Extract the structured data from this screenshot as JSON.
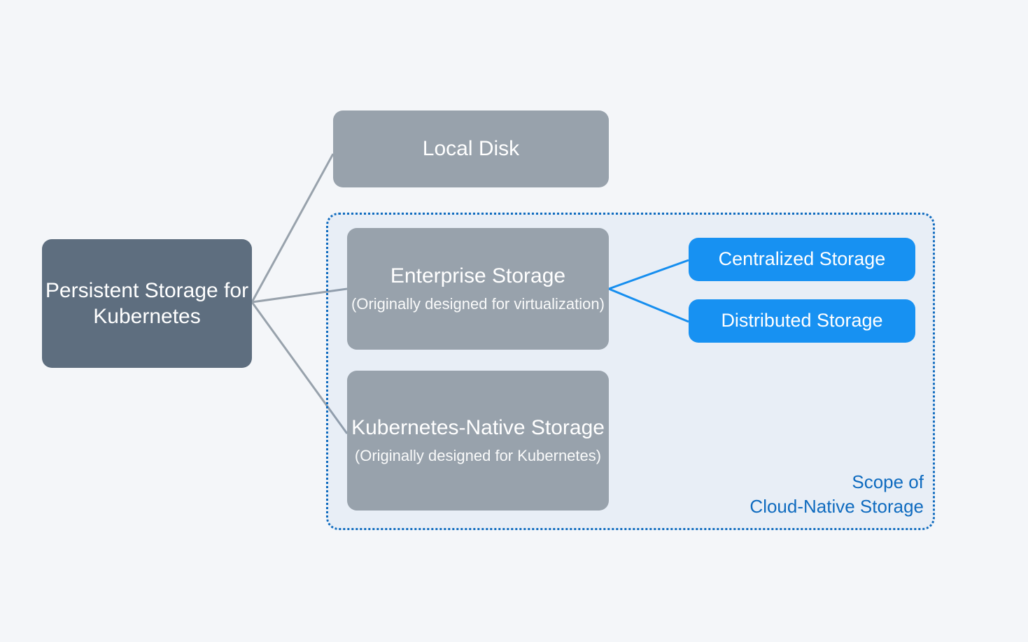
{
  "root": {
    "label": "Persistent Storage for Kubernetes"
  },
  "branches": {
    "local_disk": {
      "label": "Local Disk"
    },
    "enterprise_storage": {
      "label": "Enterprise Storage",
      "subtitle": "(Originally designed for virtualization)"
    },
    "k8s_native_storage": {
      "label": "Kubernetes-Native Storage",
      "subtitle": "(Originally designed for Kubernetes)"
    }
  },
  "leaves": {
    "centralized": {
      "label": "Centralized Storage"
    },
    "distributed": {
      "label": "Distributed Storage"
    }
  },
  "scope": {
    "label_line1": "Scope of",
    "label_line2": "Cloud-Native Storage"
  },
  "colors": {
    "root_bg": "#5e6e7f",
    "branch_bg": "#98a2ac",
    "leaf_bg": "#1791f2",
    "scope_border": "#0f6bbf",
    "gray_line": "#98a2ac",
    "blue_line": "#1791f2"
  }
}
